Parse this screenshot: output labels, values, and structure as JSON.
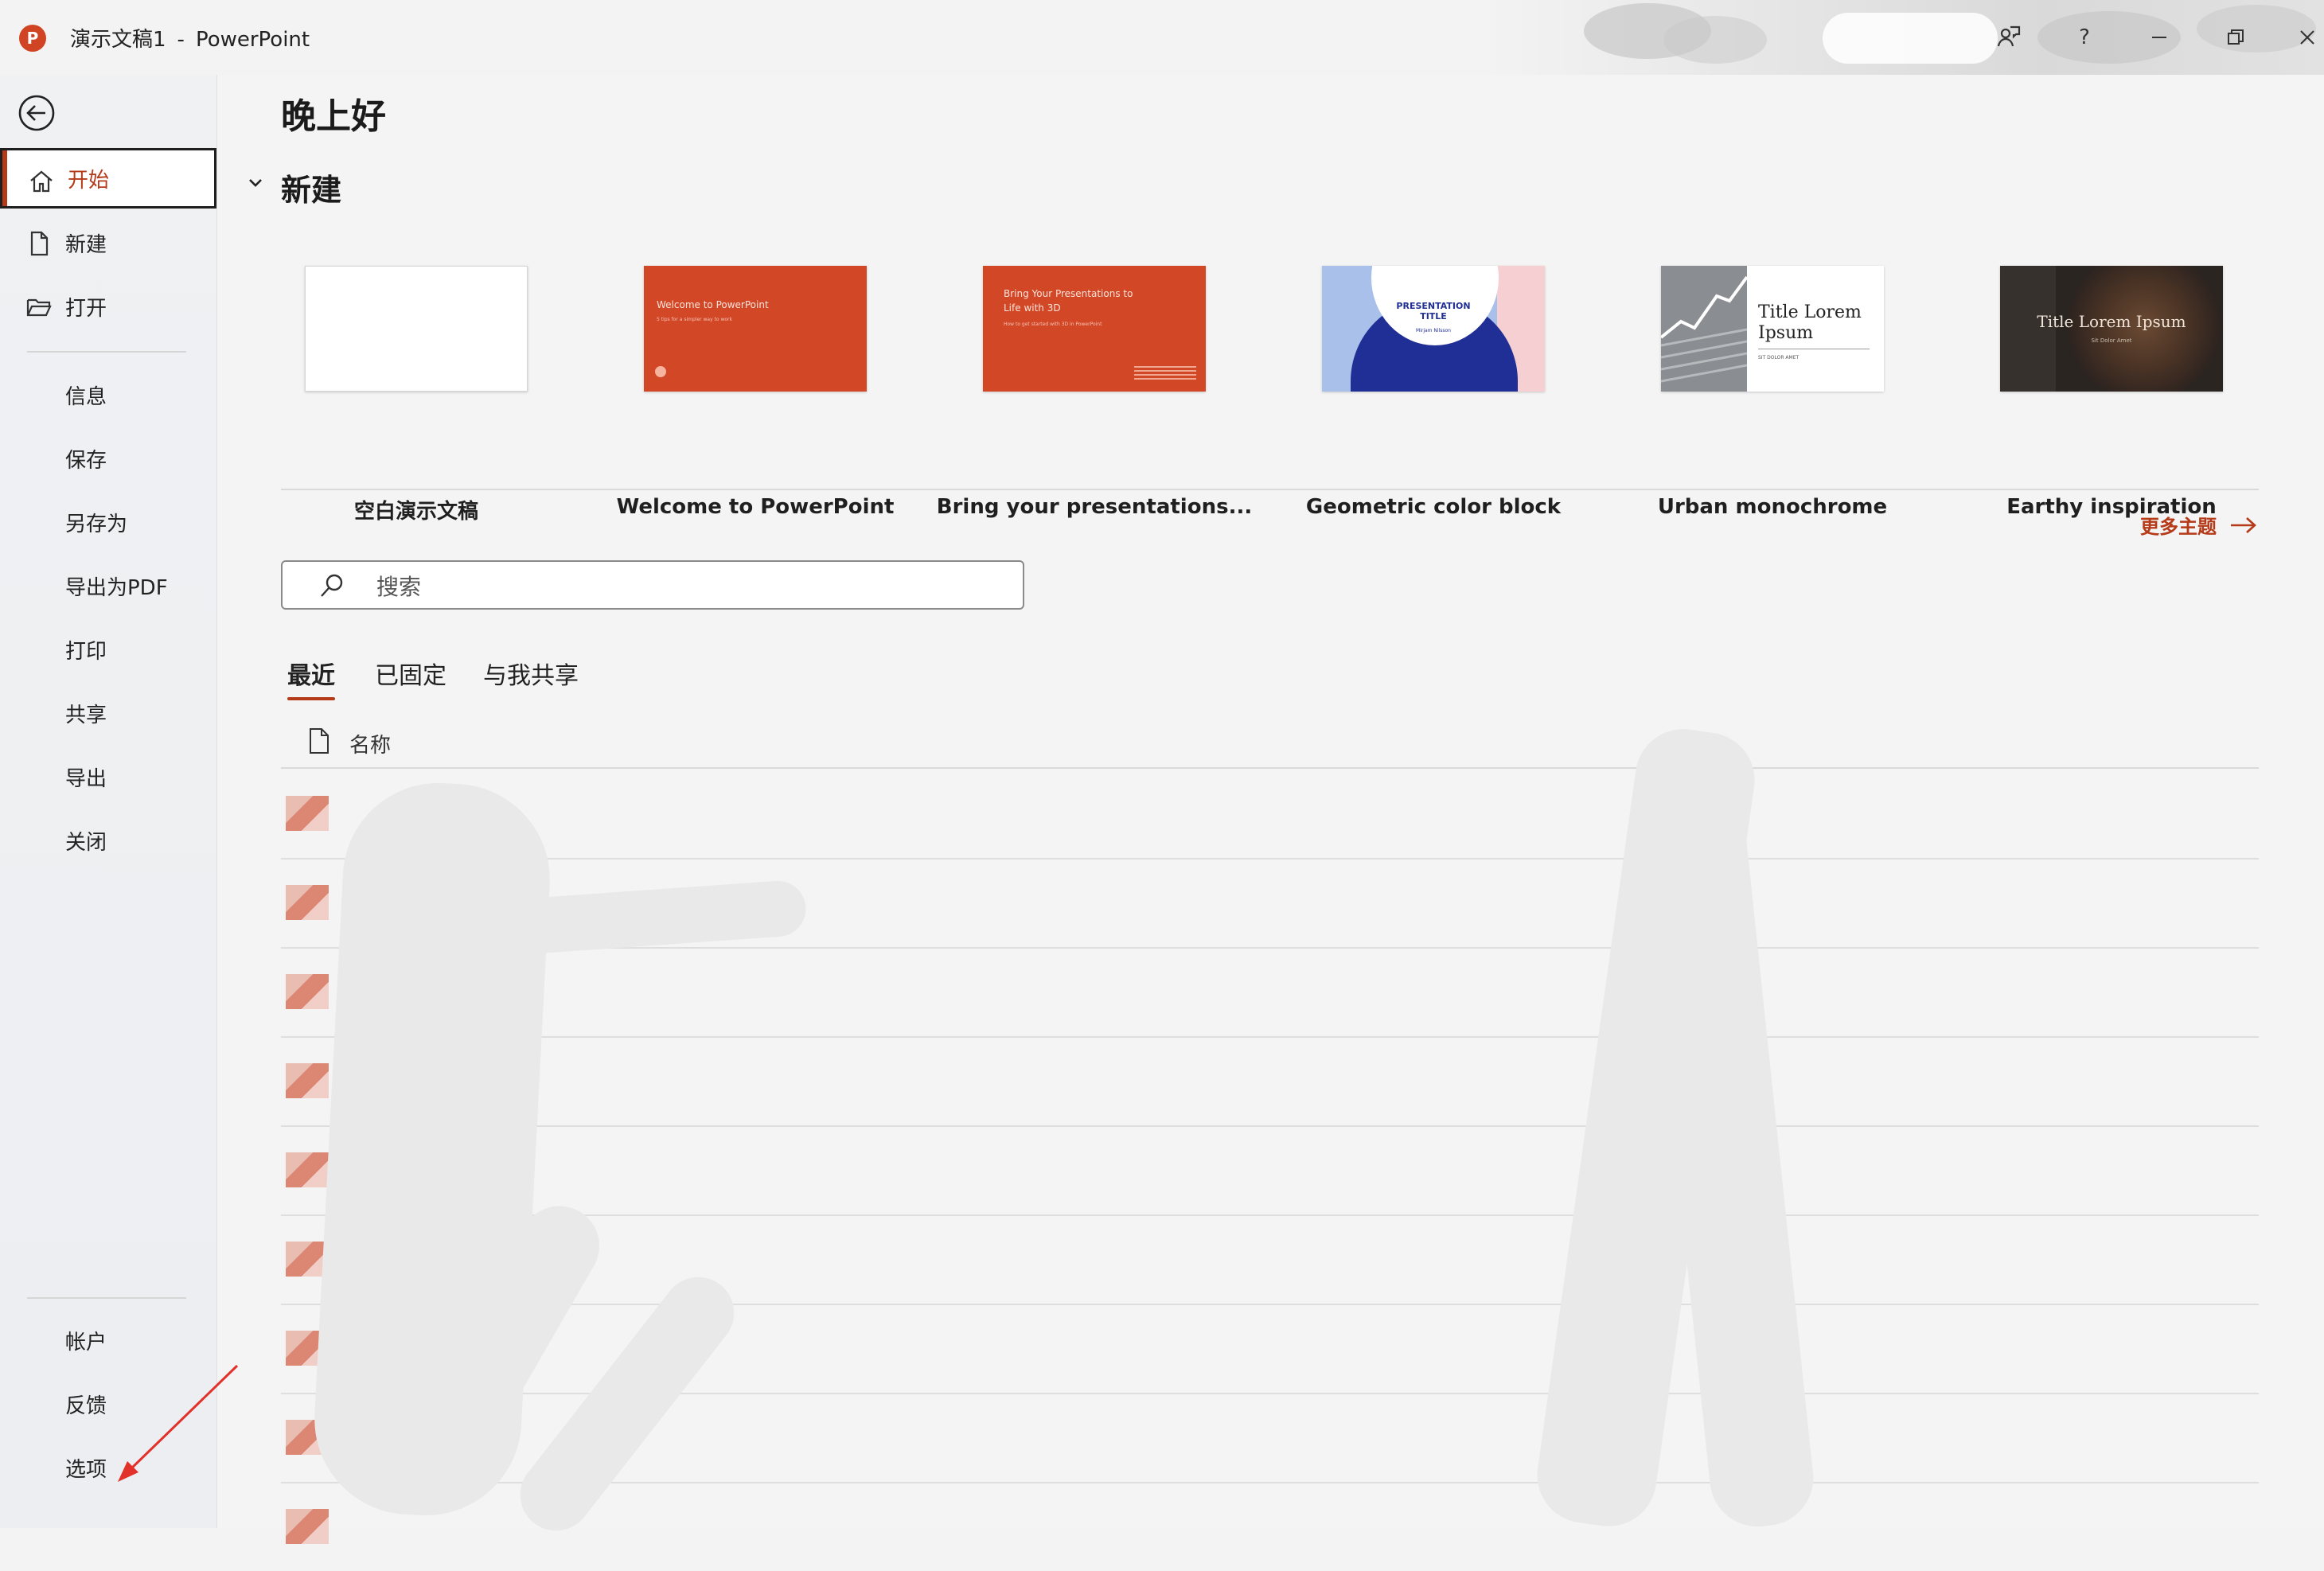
{
  "window": {
    "app_name": "PowerPoint",
    "doc_name": "演示文稿1",
    "separator": "-",
    "logo_letter": "P"
  },
  "titlebar_icons": [
    "coauthor-icon",
    "help-icon",
    "minimize-icon",
    "restore-icon",
    "close-icon"
  ],
  "nav": {
    "top": [
      {
        "label": "开始",
        "icon": "home-icon",
        "active": true
      },
      {
        "label": "新建",
        "icon": "new-doc-icon"
      },
      {
        "label": "打开",
        "icon": "folder-icon"
      }
    ],
    "middle": [
      "信息",
      "保存",
      "另存为",
      "导出为PDF",
      "打印",
      "共享",
      "导出",
      "关闭"
    ],
    "bottom": [
      "帐户",
      "反馈",
      "选项"
    ]
  },
  "main": {
    "greeting": "晚上好",
    "new_section_title": "新建",
    "templates": [
      {
        "name": "空白演示文稿",
        "style": "blank"
      },
      {
        "name": "Welcome to PowerPoint",
        "style": "welcome",
        "thumb_title": "Welcome to PowerPoint",
        "thumb_sub": "5 tips for a simpler way to work"
      },
      {
        "name": "Bring your presentations...",
        "style": "bring3d",
        "thumb_title": "Bring Your Presentations to Life with 3D",
        "thumb_sub": "How to get started with 3D in PowerPoint"
      },
      {
        "name": "Geometric color block",
        "style": "geometric",
        "thumb_title": "PRESENTATION TITLE",
        "thumb_sub": "Mirjam Nilsson"
      },
      {
        "name": "Urban monochrome",
        "style": "urban",
        "thumb_title": "Title Lorem Ipsum",
        "thumb_sub": "SIT DOLOR AMET"
      },
      {
        "name": "Earthy inspiration",
        "style": "earthy",
        "thumb_title": "Title Lorem Ipsum",
        "thumb_sub": "Sit Dolor Amet"
      }
    ],
    "more_themes_label": "更多主题",
    "search_placeholder": "搜索",
    "tabs": [
      {
        "label": "最近",
        "active": true
      },
      {
        "label": "已固定"
      },
      {
        "label": "与我共享"
      }
    ],
    "column_name_header": "名称",
    "recent_file_count": 9
  },
  "colors": {
    "accent": "#b43a18",
    "template_orange": "#d24726",
    "geo_navy": "#1f2f95",
    "geo_blue": "#a9c0ea",
    "geo_pink": "#f5cfd2"
  }
}
